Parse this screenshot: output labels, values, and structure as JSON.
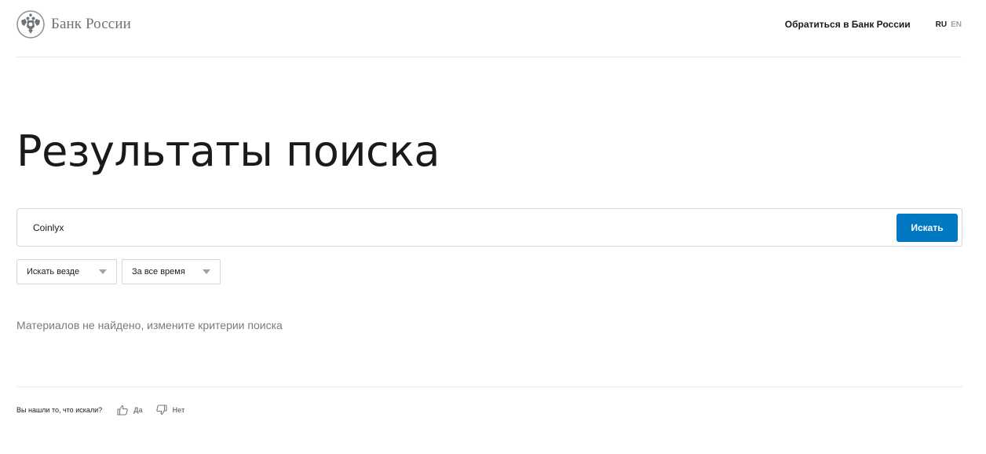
{
  "header": {
    "logo_text": "Банк России",
    "contact_link": "Обратиться в Банк России",
    "lang_ru": "RU",
    "lang_en": "EN"
  },
  "page": {
    "title": "Результаты поиска"
  },
  "search": {
    "value": "Coinlyx",
    "button_label": "Искать"
  },
  "filters": {
    "where": "Искать везде",
    "time": "За все время"
  },
  "results": {
    "empty_message": "Материалов не найдено, измените критерии поиска"
  },
  "feedback": {
    "question": "Вы нашли то, что искали?",
    "yes": "Да",
    "no": "Нет"
  },
  "colors": {
    "accent": "#0079c2",
    "muted_text": "#757b80",
    "border": "#d3d6da"
  },
  "icons": {
    "logo": "double-headed-eagle-emblem",
    "filter_caret": "caret-down-icon",
    "yes": "thumbs-up-icon",
    "no": "thumbs-down-icon"
  }
}
